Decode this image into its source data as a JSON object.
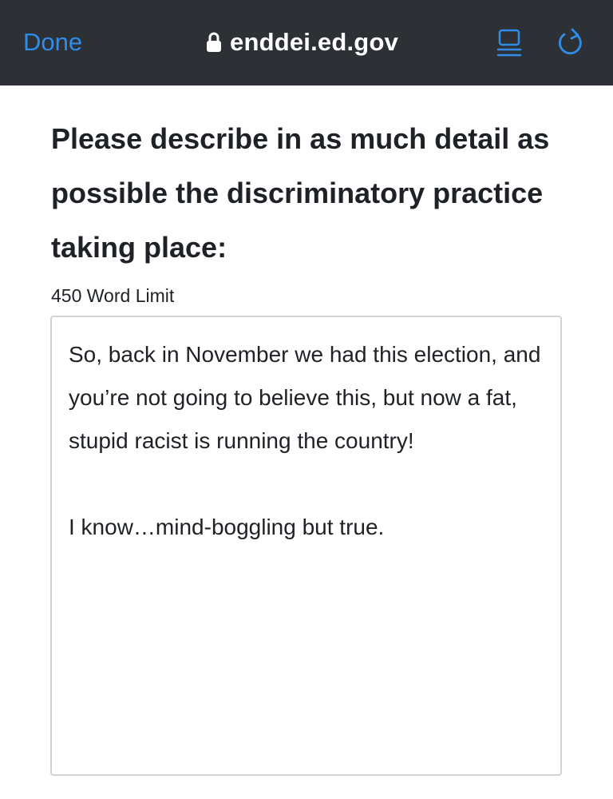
{
  "browser": {
    "done_label": "Done",
    "url": "enddei.ed.gov",
    "lock_icon": "lock-icon",
    "reader_icon": "reader-view-icon",
    "reload_icon": "reload-icon",
    "accent_color": "#2f8ce9",
    "bar_color": "#2d3136"
  },
  "form": {
    "question": "Please describe in as much detail as possible the discriminatory practice taking place:",
    "word_limit": "450 Word Limit",
    "answer_value": "So, back in November we had this election, and you’re not going to believe this, but now a fat, stupid racist is running the country!\n\nI know…mind-boggling but true."
  }
}
